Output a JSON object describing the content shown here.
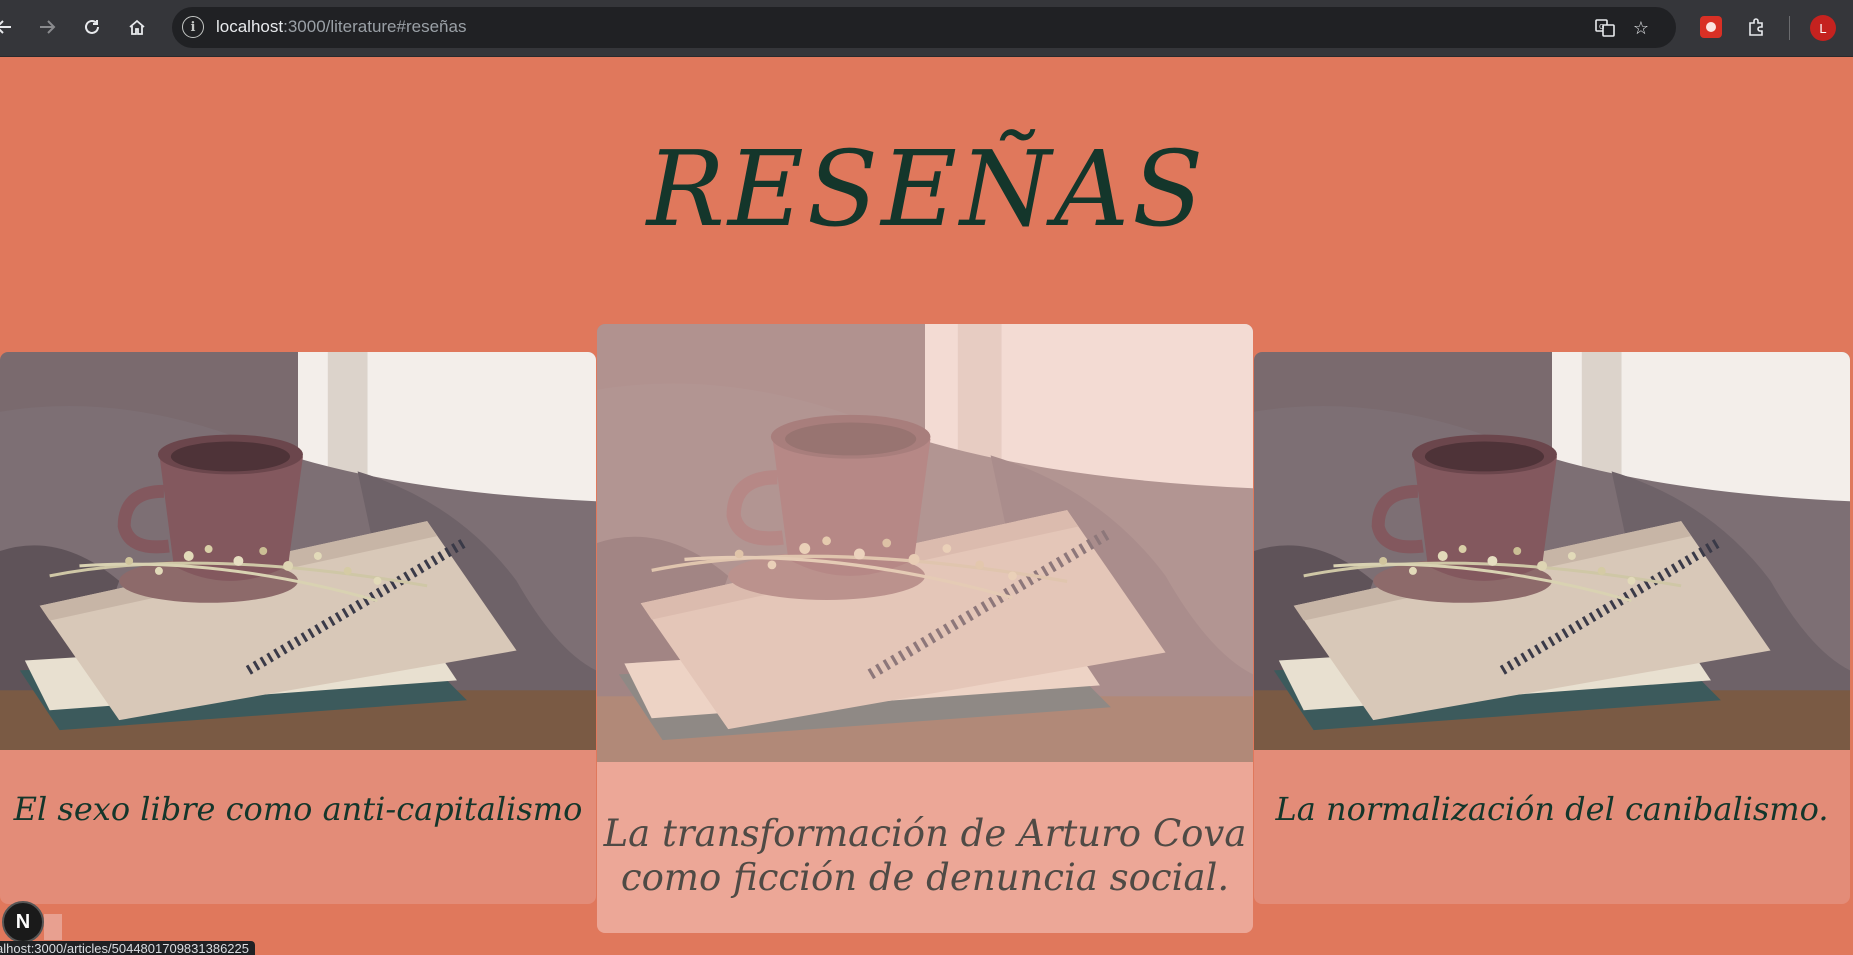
{
  "browser": {
    "url_host": "localhost",
    "url_rest": ":3000/literature#reseñas",
    "profile_initial": "L",
    "status_url": "alhost:3000/articles/5044801709831386225"
  },
  "page": {
    "title": "RESEÑAS"
  },
  "cards": [
    {
      "caption": "El sexo libre como anti-capitalismo"
    },
    {
      "caption_line1": "La transformación de Arturo Cova",
      "caption_line2": "como ficción de denuncia social."
    },
    {
      "caption": "La normalización del canibalismo."
    }
  ],
  "devtools": {
    "badge": "N"
  },
  "colors": {
    "page_bg": "#e0785c",
    "title": "#14362b",
    "card_bg": "#e38c78"
  },
  "icons": [
    "back-icon",
    "forward-icon",
    "reload-icon",
    "home-icon",
    "info-icon",
    "translate-icon",
    "star-icon",
    "extension-icon",
    "puzzle-icon"
  ]
}
